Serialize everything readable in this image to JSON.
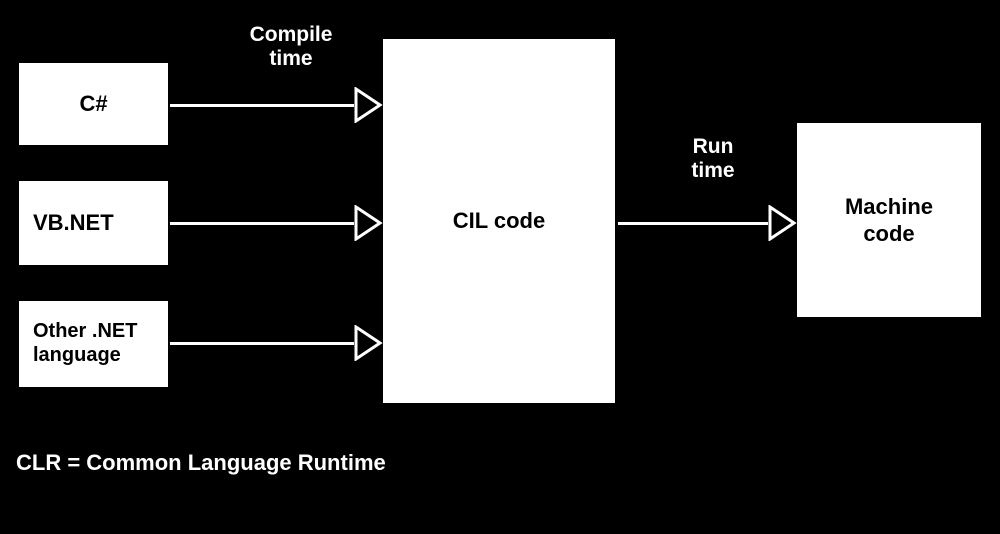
{
  "boxes": {
    "csharp": "C#",
    "vbnet": "VB.NET",
    "othernet": "Other .NET\nlanguage",
    "cil": "CIL code",
    "machine": "Machine\ncode"
  },
  "labels": {
    "compiletime": "Compile\ntime",
    "runtime": "Run\ntime",
    "clr": "CLR = Common Language Runtime"
  }
}
